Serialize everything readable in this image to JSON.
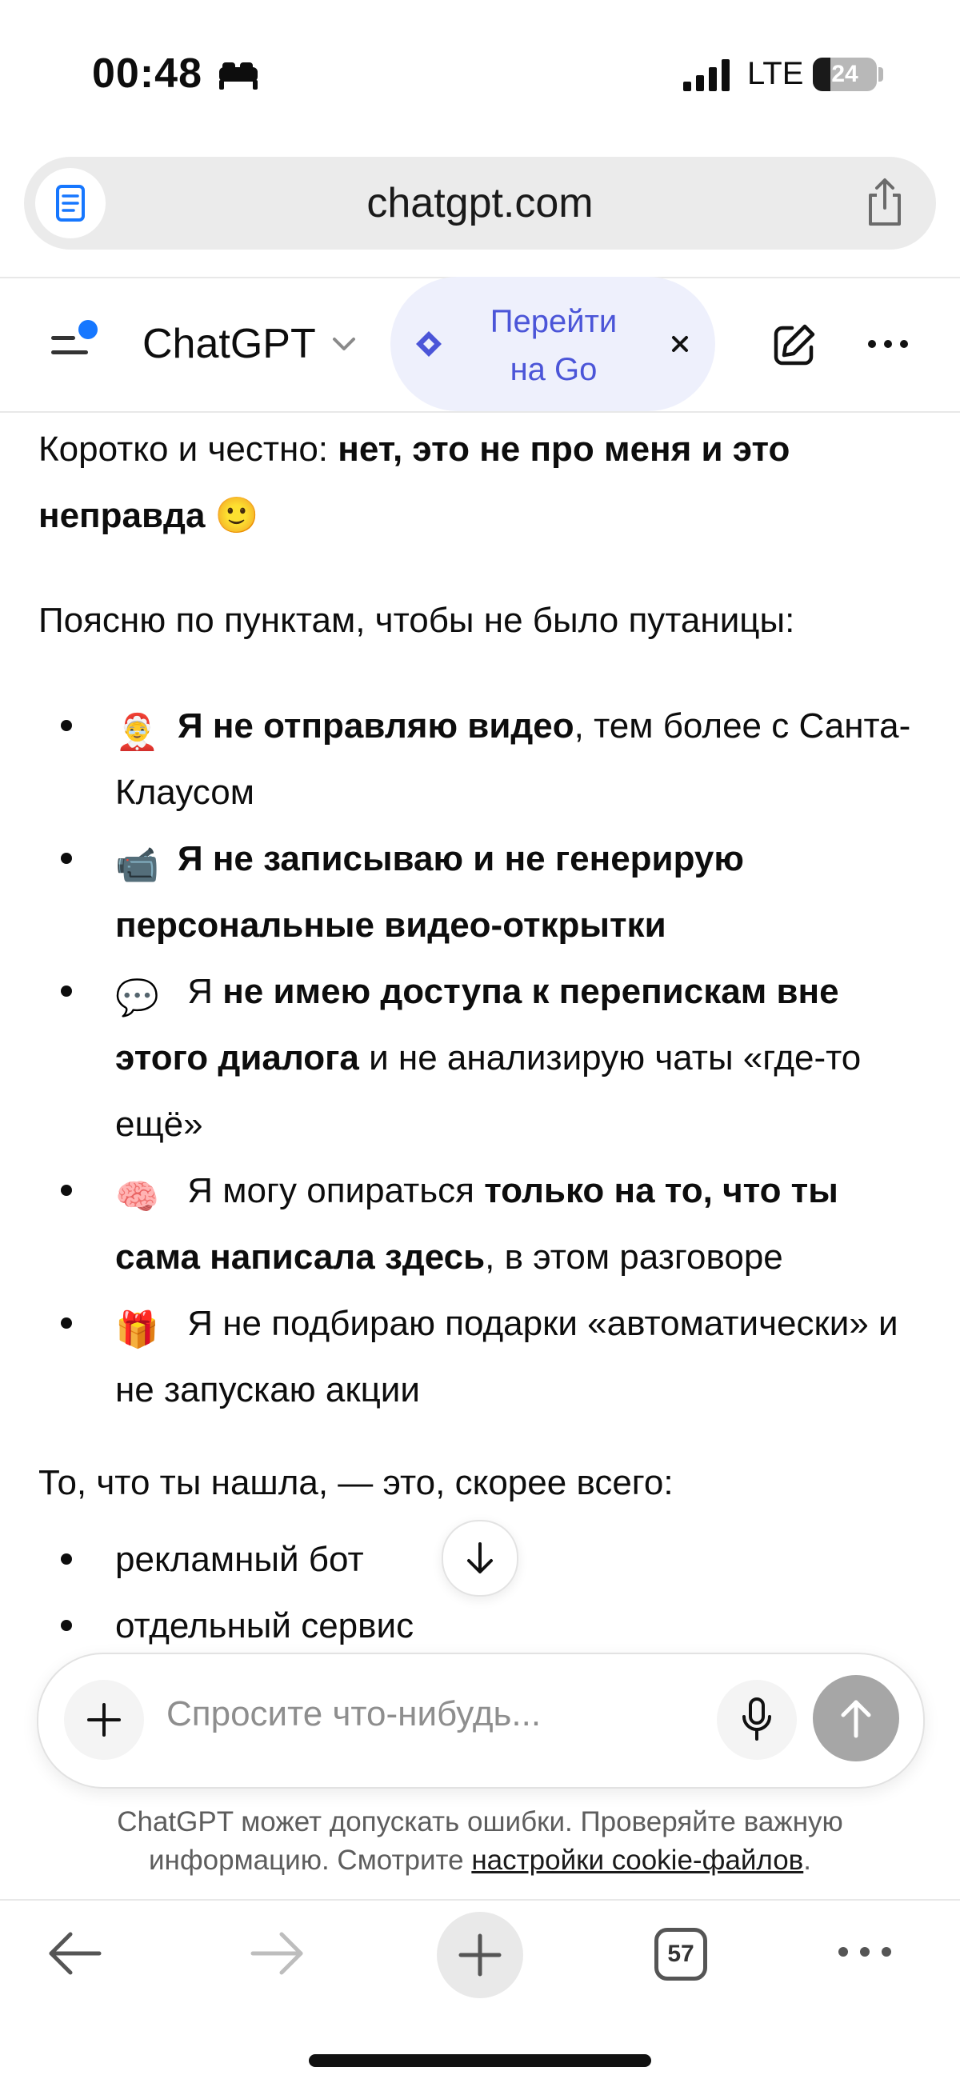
{
  "status_bar": {
    "time": "00:48",
    "network": "LTE",
    "battery": "24"
  },
  "browser": {
    "url": "chatgpt.com",
    "tabs_count": "57"
  },
  "header": {
    "title": "ChatGPT",
    "upgrade_label_line1": "Перейти",
    "upgrade_label_line2": "на Go",
    "close_glyph": "×"
  },
  "message": {
    "p1_plain": "Коротко и честно: ",
    "p1_bold": "нет, это не про меня и это неправда",
    "p1_emoji": "🙂",
    "p2": "Поясню по пунктам, чтобы не было путаницы:",
    "bullets": [
      {
        "emoji": "🤶",
        "bold": "Я не отправляю видео",
        "rest": ", тем более с Санта-Клаусом"
      },
      {
        "emoji": "📹",
        "bold": "Я не записываю и не генерирую персональные видео-открытки",
        "rest": ""
      },
      {
        "emoji": "💬",
        "pre": " Я ",
        "bold": "не имею доступа к перепискам вне этого диалога",
        "rest": " и не анализирую чаты «где-то ещё»"
      },
      {
        "emoji": "🧠",
        "pre": " Я могу опираться ",
        "bold": "только на то, что ты сама написала здесь",
        "rest": ", в этом разговоре"
      },
      {
        "emoji": "🎁",
        "rest": " Я не подбираю подарки «автоматически» и не запускаю акции"
      }
    ],
    "p3": "То, что ты нашла, — это, скорее всего:",
    "sub_bullets": [
      "рекламный бот",
      "отдельный сервис"
    ]
  },
  "composer": {
    "placeholder": "Спросите что-нибудь..."
  },
  "disclaimer": {
    "text": "ChatGPT может допускать ошибки. Проверяйте важную информацию. Смотрите ",
    "link": "настройки cookie-файлов",
    "end": "."
  },
  "icons": {
    "menu": "sidebar-menu-icon",
    "edit": "new-chat-icon",
    "more": "more-icon",
    "upgrade": "sparkle-icon",
    "share": "share-icon",
    "reader": "reader-icon"
  },
  "colors": {
    "accent": "#1677ff",
    "go_pill_bg": "#eef0fc",
    "go_text": "#4b55d8",
    "send_disabled": "#a6a6a6"
  }
}
